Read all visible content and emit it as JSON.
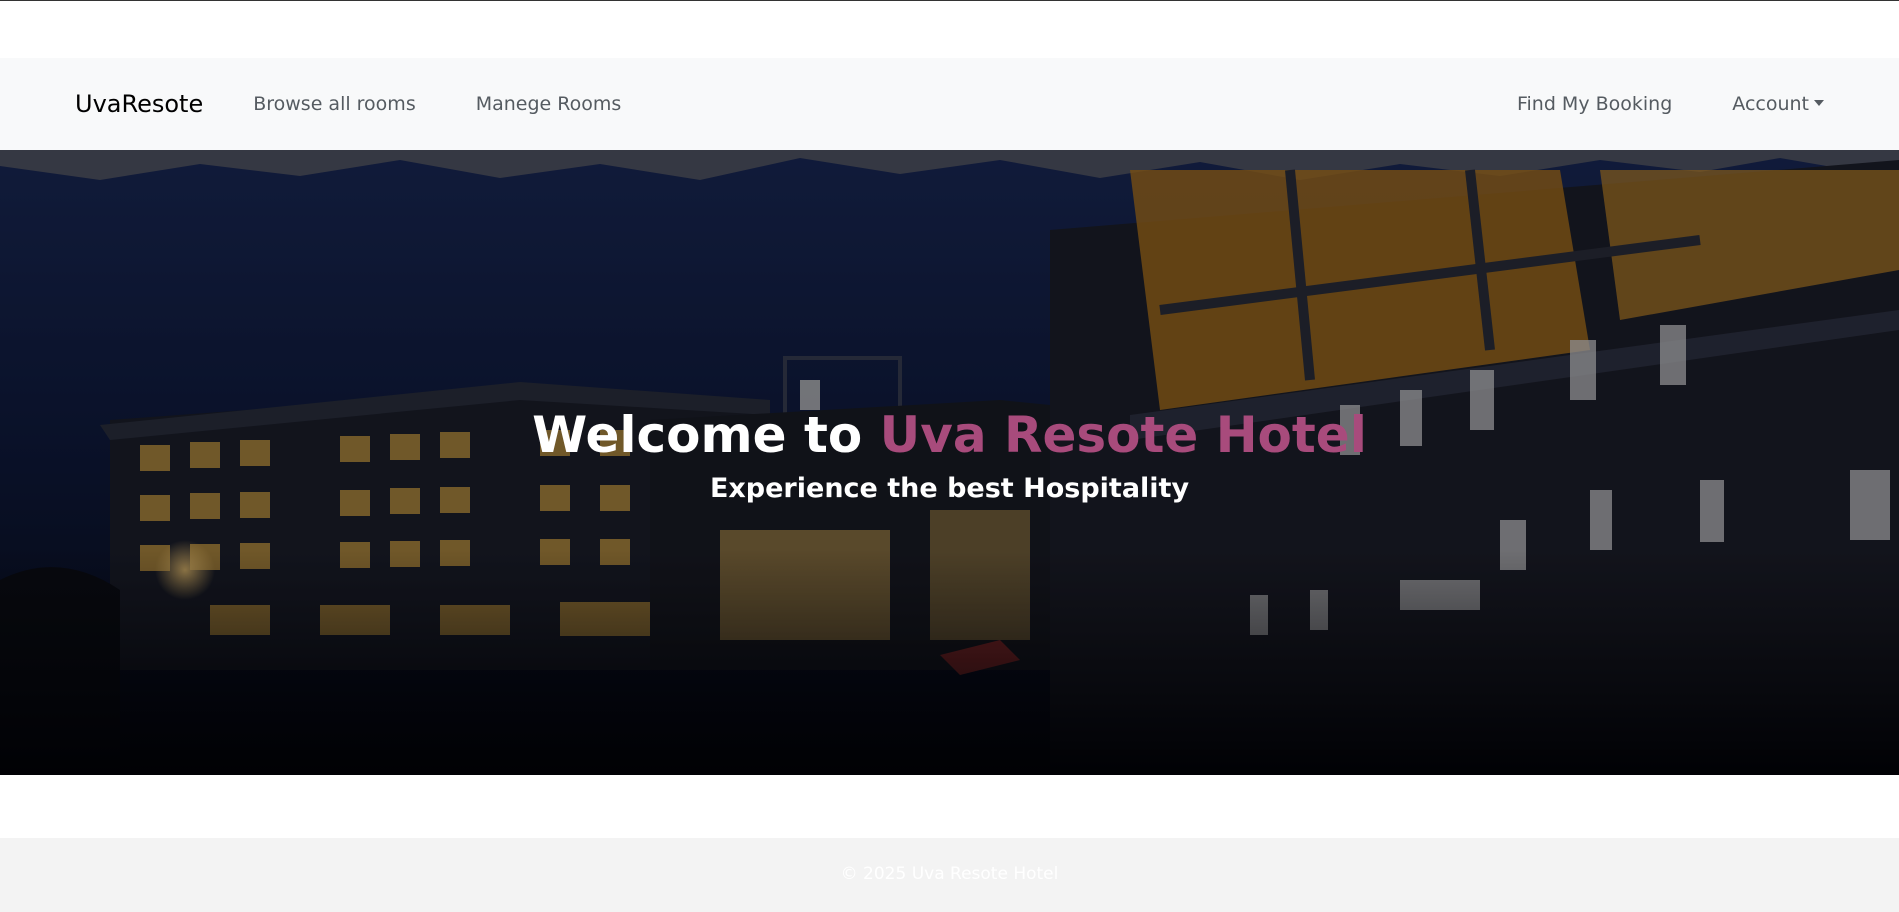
{
  "navbar": {
    "brand": "UvaResote",
    "links": [
      "Browse all rooms",
      "Manege Rooms"
    ],
    "right_links": [
      "Find My Booking",
      "Account"
    ]
  },
  "hero": {
    "title_prefix": "Welcome to",
    "title_accent": "Uva Resote Hotel",
    "subtitle": "Experience the best Hospitality"
  },
  "footer": {
    "text": "© 2025 Uva Resote Hotel"
  },
  "colors": {
    "accent": "#a84b7c",
    "navbar_bg": "#f8f9fa",
    "footer_bg": "#f3f3f3"
  }
}
